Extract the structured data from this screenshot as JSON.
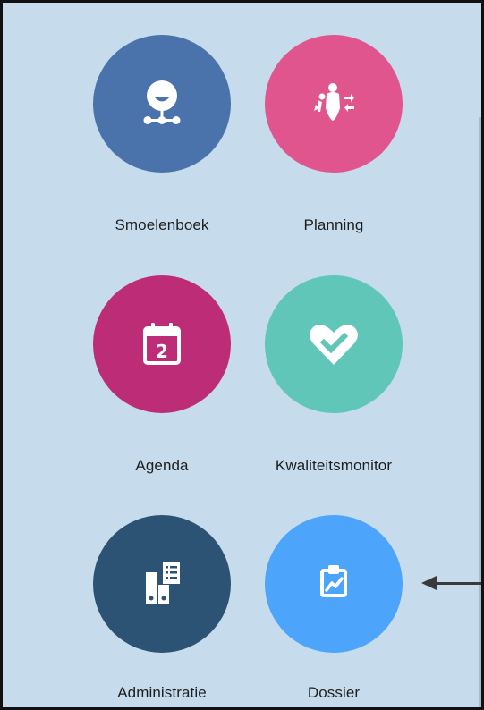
{
  "tiles": [
    {
      "label": "Smoelenboek",
      "icon": "faces-network-icon",
      "color": "#4a72ab"
    },
    {
      "label": "Planning",
      "icon": "people-arrows-icon",
      "color": "#e0558e"
    },
    {
      "label": "Agenda",
      "icon": "calendar-2-icon",
      "color": "#bd2c77"
    },
    {
      "label": "Kwaliteitsmonitor",
      "icon": "heart-check-icon",
      "color": "#5fc6b8"
    },
    {
      "label": "Administratie",
      "icon": "binders-document-icon",
      "color": "#2c5373"
    },
    {
      "label": "Dossier",
      "icon": "clipboard-chart-icon",
      "color": "#4da4fb"
    }
  ],
  "calendar_day": "2",
  "colors": {
    "background": "#c6dced",
    "border": "#111111",
    "annotation_arrow": "#3a3a3a"
  }
}
